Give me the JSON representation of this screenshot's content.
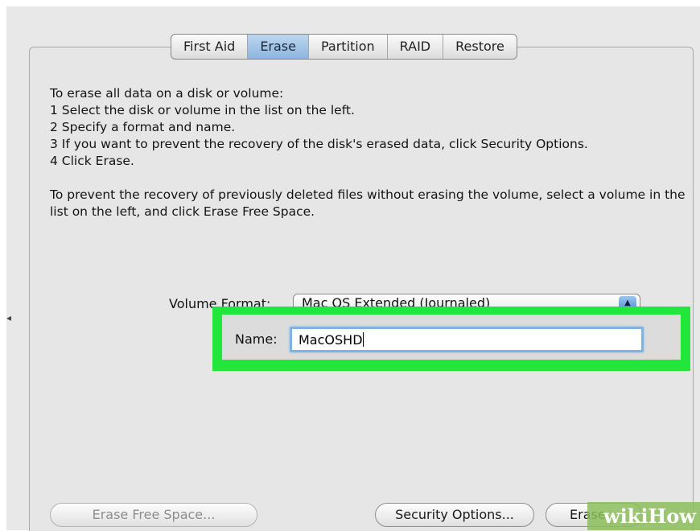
{
  "tabs": [
    {
      "label": "First Aid",
      "active": false
    },
    {
      "label": "Erase",
      "active": true
    },
    {
      "label": "Partition",
      "active": false
    },
    {
      "label": "RAID",
      "active": false
    },
    {
      "label": "Restore",
      "active": false
    }
  ],
  "instructions": {
    "line1": "To erase all data on a disk or volume:",
    "line2": "1 Select the disk or volume in the list on the left.",
    "line3": "2 Specify a format and name.",
    "line4": "3 If you want to prevent the recovery of the disk's erased data, click Security Options.",
    "line5": "4 Click Erase.",
    "paragraph2": "To prevent the recovery of previously deleted files without erasing the volume, select a volume in the list on the left, and click Erase Free Space."
  },
  "volume_format": {
    "label": "Volume Format:",
    "value": "Mac OS Extended (Journaled)"
  },
  "name_field": {
    "label": "Name:",
    "value": "MacOSHD"
  },
  "buttons": {
    "erase_free_space": "Erase Free Space...",
    "security_options": "Security Options...",
    "erase": "Erase..."
  },
  "watermark": "wikiHow",
  "colors": {
    "highlight": "#22e63a",
    "active_tab": "#8db5de",
    "input_focus": "#7fb2e6"
  }
}
